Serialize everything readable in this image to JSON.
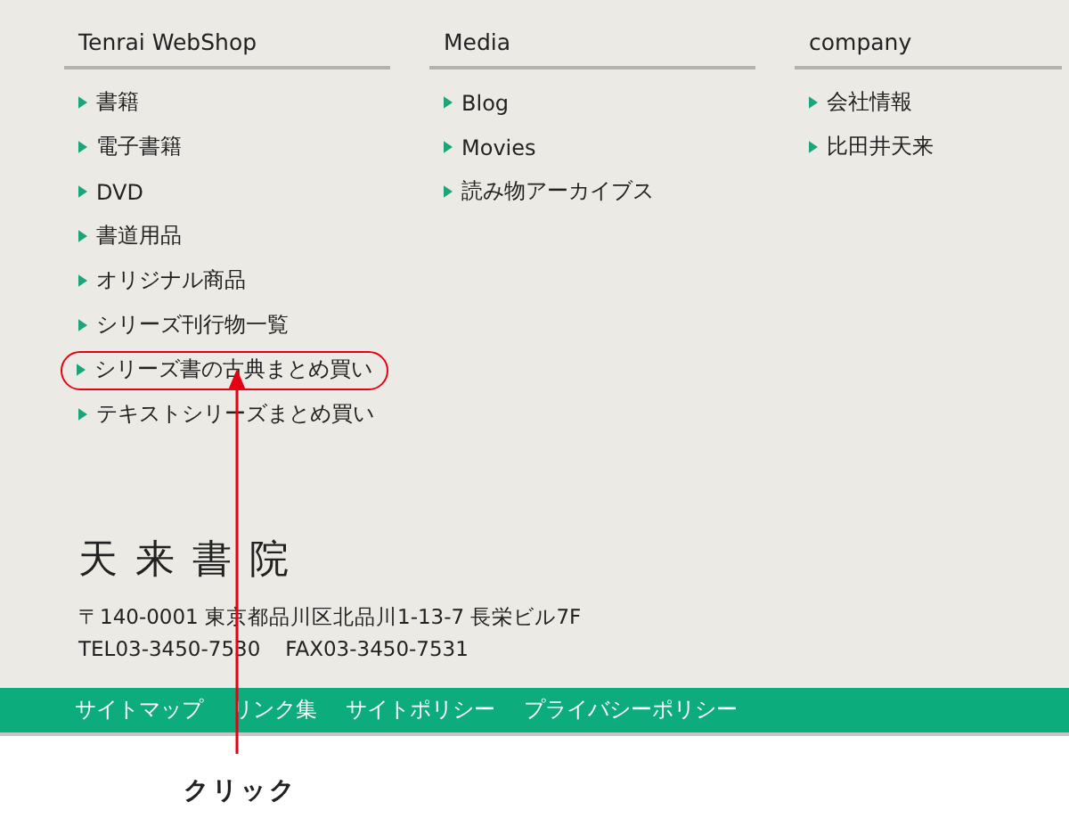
{
  "columns": [
    {
      "heading": "Tenrai WebShop",
      "items": [
        {
          "label": "書籍",
          "highlighted": false
        },
        {
          "label": "電子書籍",
          "highlighted": false
        },
        {
          "label": "DVD",
          "highlighted": false
        },
        {
          "label": "書道用品",
          "highlighted": false
        },
        {
          "label": "オリジナル商品",
          "highlighted": false
        },
        {
          "label": "シリーズ刊行物一覧",
          "highlighted": false
        },
        {
          "label": "シリーズ書の古典まとめ買い",
          "highlighted": true
        },
        {
          "label": "テキストシリーズまとめ買い",
          "highlighted": false
        }
      ]
    },
    {
      "heading": "Media",
      "items": [
        {
          "label": "Blog",
          "highlighted": false
        },
        {
          "label": "Movies",
          "highlighted": false
        },
        {
          "label": "読み物アーカイブス",
          "highlighted": false
        }
      ]
    },
    {
      "heading": "company",
      "items": [
        {
          "label": "会社情報",
          "highlighted": false
        },
        {
          "label": "比田井天来",
          "highlighted": false
        }
      ]
    }
  ],
  "logo": "天来書院",
  "address": "〒140-0001 東京都品川区北品川1-13-7 長栄ビル7F",
  "phone": "TEL03-3450-7530",
  "fax": "FAX03-3450-7531",
  "bottom_links": [
    "サイトマップ",
    "リンク集",
    "サイトポリシー",
    "プライバシーポリシー"
  ],
  "annotation": {
    "label": "クリック"
  }
}
